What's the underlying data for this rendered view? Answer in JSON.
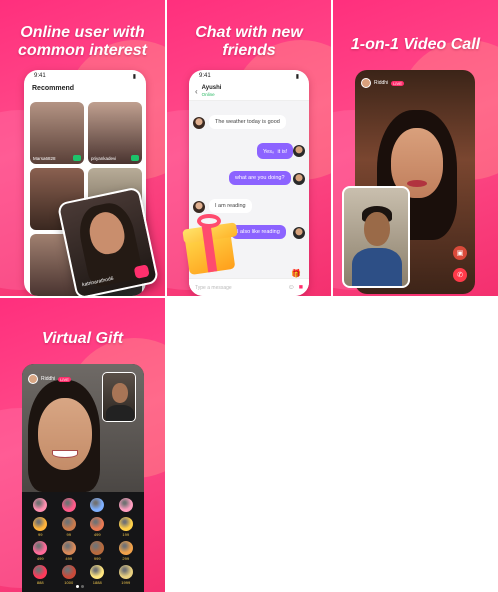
{
  "panels": {
    "users": {
      "headline_line1": "Online user with",
      "headline_line2": "common interest",
      "status_time": "9:41",
      "section_title": "Recommend",
      "cards": [
        {
          "name": "Marsa6828",
          "bg": "#8a6a5a"
        },
        {
          "name": "priyankadevi",
          "bg": "#6a4a44"
        },
        {
          "name": "",
          "bg": "#5a4038"
        },
        {
          "name": "",
          "bg": "#8a8070"
        },
        {
          "name": "",
          "bg": "#6a5048"
        },
        {
          "name": "",
          "bg": "#4a4a48"
        }
      ],
      "featured_name": "katrinarathod6"
    },
    "chat": {
      "headline_line1": "Chat with new",
      "headline_line2": "friends",
      "status_time": "9:41",
      "contact_name": "Ayushi",
      "contact_status": "Online",
      "messages": [
        {
          "dir": "in",
          "text": "The weather today is good"
        },
        {
          "dir": "out",
          "text": "Yes。it is!"
        },
        {
          "dir": "out",
          "text": "what are you doing?"
        },
        {
          "dir": "in",
          "text": "I am reading"
        },
        {
          "dir": "out",
          "text": "I also like reading"
        }
      ],
      "input_placeholder": "Type a message"
    },
    "video": {
      "headline": "1-on-1 Video Call",
      "caller_name": "Riddhi",
      "live_badge": "LIVE"
    },
    "gift": {
      "headline": "Virtual Gift",
      "caller_name": "Riddhi",
      "live_badge": "LIVE",
      "gifts": [
        {
          "price": "",
          "color": "#ff8fb0"
        },
        {
          "price": "",
          "color": "#ff5a8a"
        },
        {
          "price": "",
          "color": "#7fb0ff"
        },
        {
          "price": "",
          "color": "#ff9ec0"
        },
        {
          "price": "99",
          "color": "#ffb33a"
        },
        {
          "price": "99",
          "color": "#c97a4c"
        },
        {
          "price": "499",
          "color": "#e87a54"
        },
        {
          "price": "199",
          "color": "#ffd04a"
        },
        {
          "price": "499",
          "color": "#ff6b9a"
        },
        {
          "price": "499",
          "color": "#d98a5a"
        },
        {
          "price": "999",
          "color": "#b86b3e"
        },
        {
          "price": "299",
          "color": "#f2a24a"
        },
        {
          "price": "888",
          "color": "#ff3a5a"
        },
        {
          "price": "1000",
          "color": "#c94a3a"
        },
        {
          "price": "1888",
          "color": "#ffe680"
        },
        {
          "price": "1999",
          "color": "#e8d080"
        }
      ]
    }
  }
}
